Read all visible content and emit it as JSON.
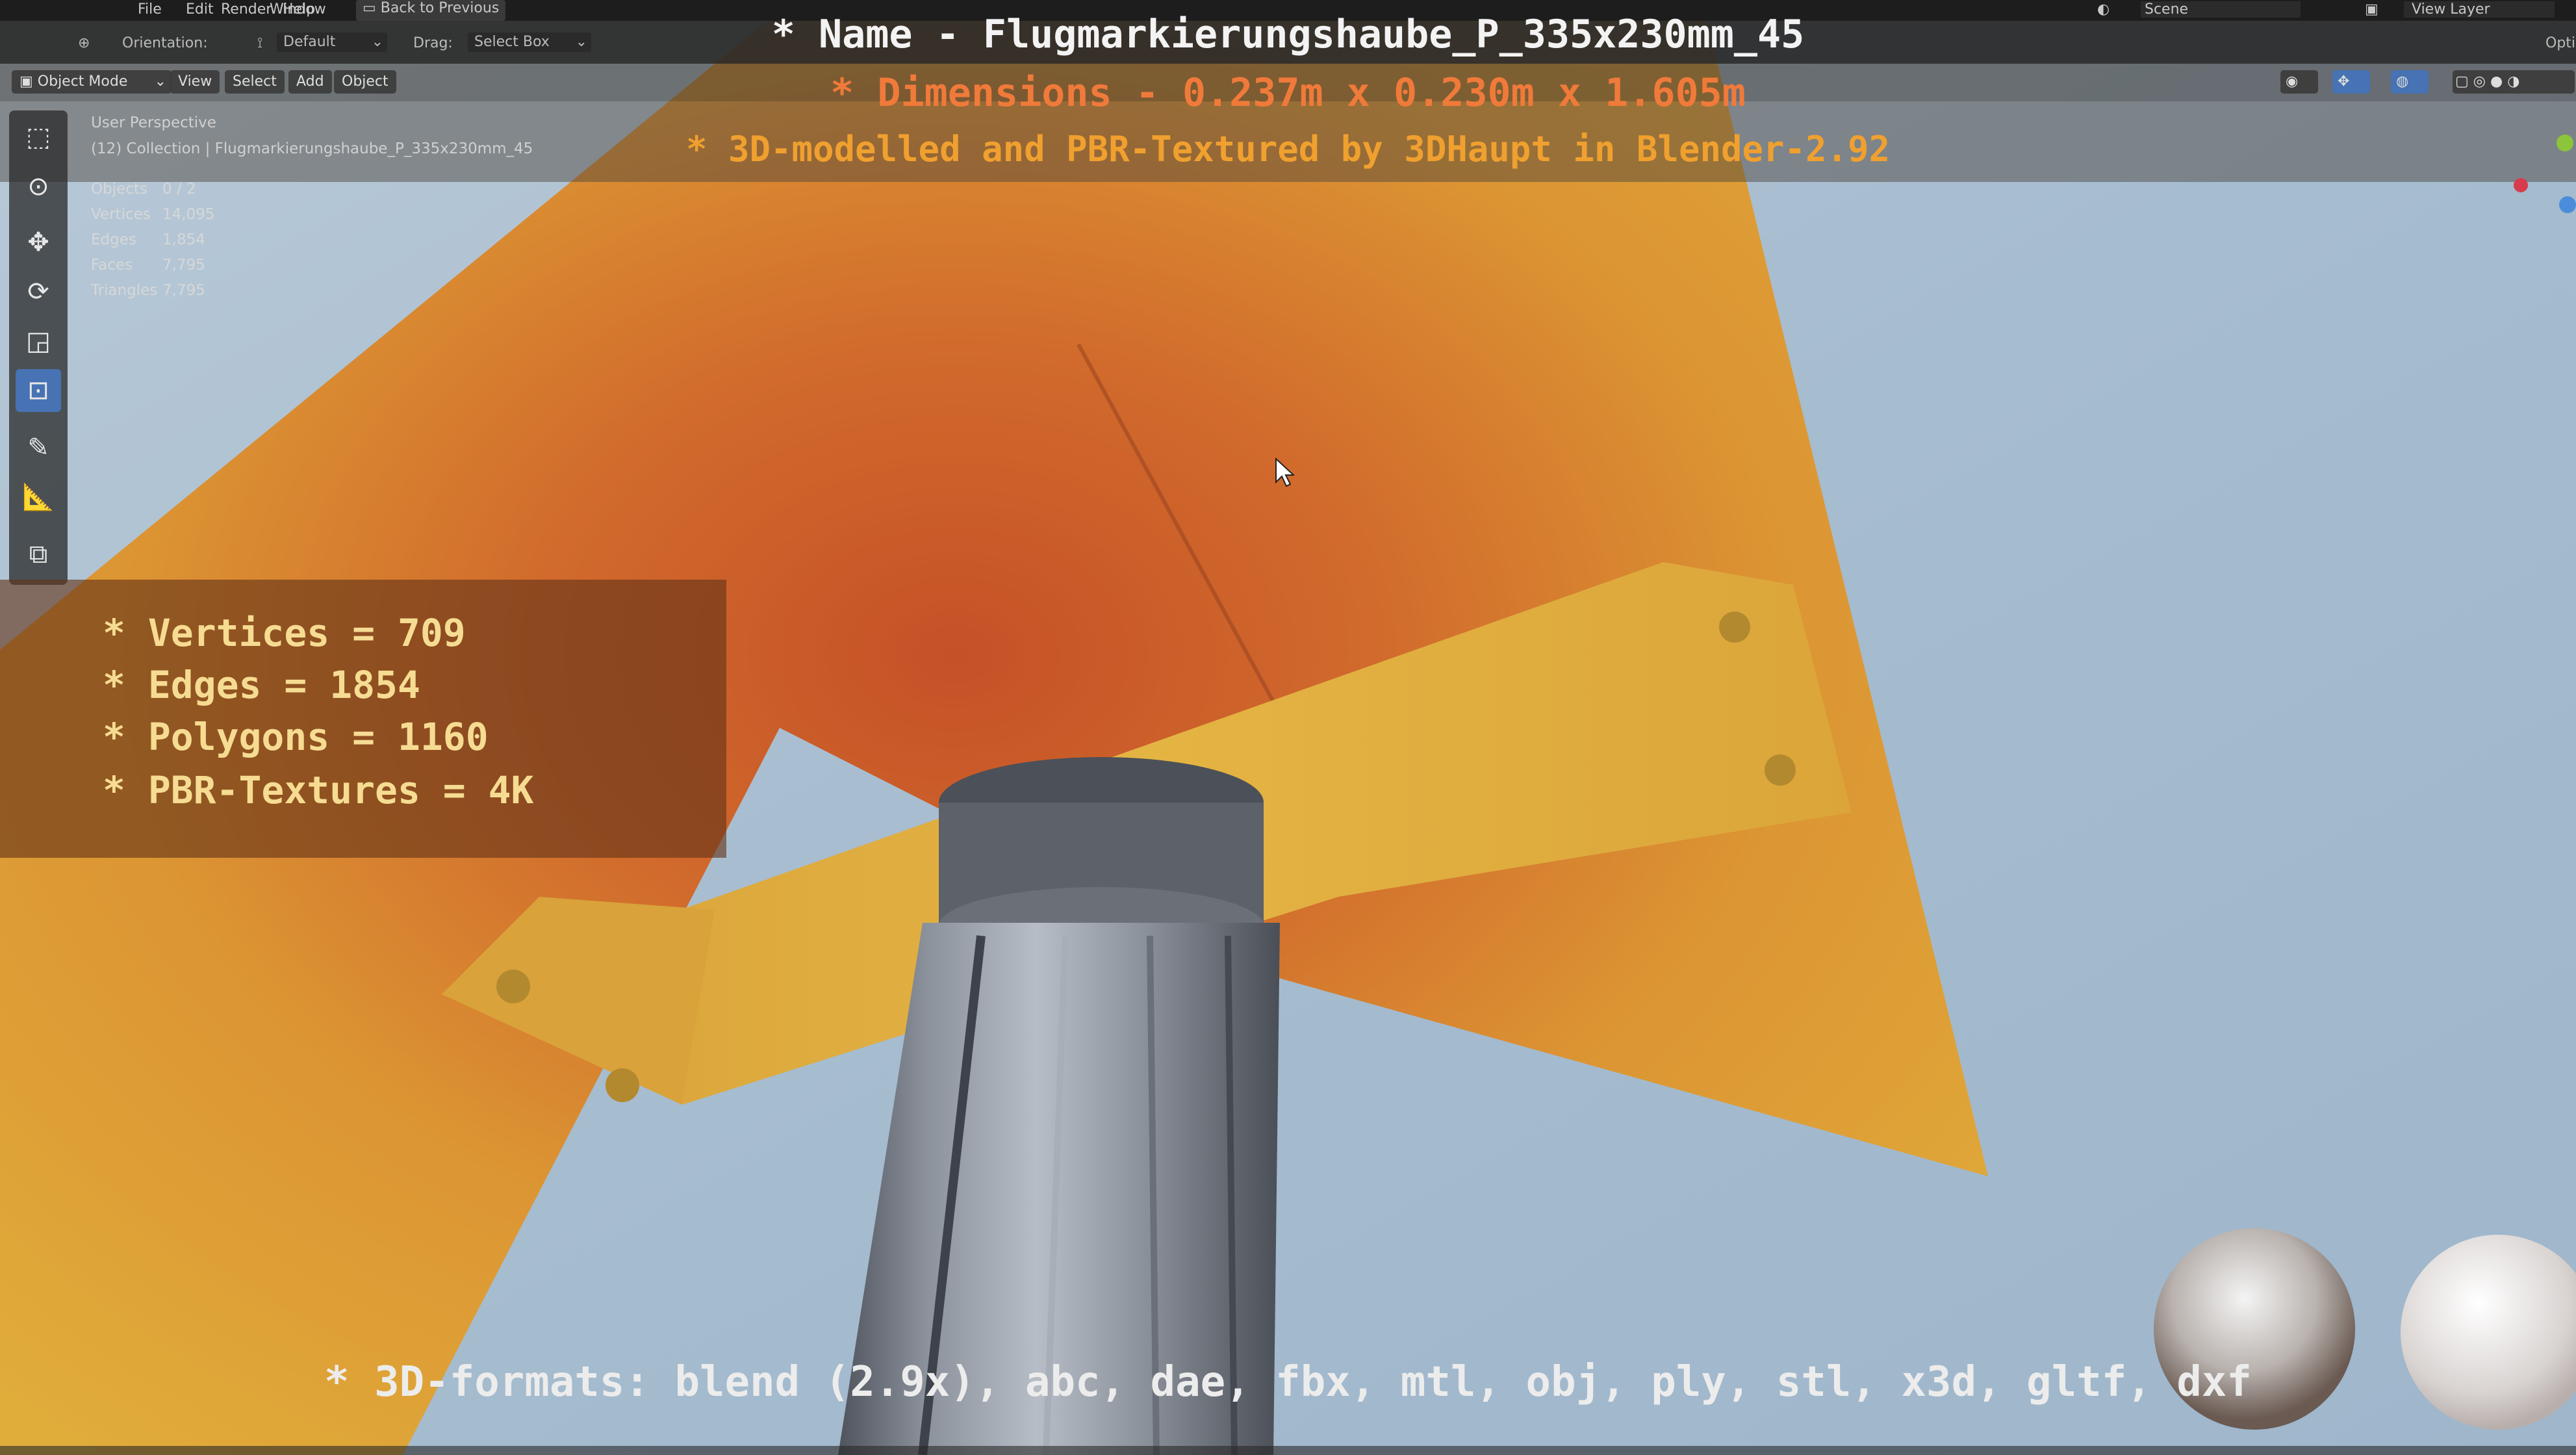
{
  "menubar": {
    "left_items": [
      "File",
      "Edit",
      "Render",
      "Window",
      "Help"
    ],
    "back_label": "Back to Previous",
    "scene_label": "Scene",
    "view_layer_label": "View Layer"
  },
  "header": {
    "orientation_label": "Orientation:",
    "orientation_value": "Default",
    "drag_label": "Drag:",
    "drag_value": "Select Box",
    "options_label": "Opti"
  },
  "modebar": {
    "mode": "Object Mode",
    "menus": [
      "View",
      "Select",
      "Add",
      "Object"
    ]
  },
  "viewport": {
    "perspective": "User Perspective",
    "collection": "(12) Collection | Flugmarkierungshaube_P_335x230mm_45",
    "stats": [
      {
        "label": "Objects",
        "value": "0 / 2"
      },
      {
        "label": "Vertices",
        "value": "14,095"
      },
      {
        "label": "Edges",
        "value": "1,854"
      },
      {
        "label": "Faces",
        "value": "7,795"
      },
      {
        "label": "Triangles",
        "value": "7,795"
      }
    ]
  },
  "overlay": {
    "name_line": "* Name - Flugmarkierungshaube_P_335x230mm_45",
    "dimensions_line": "* Dimensions -  0.237m x 0.230m x 1.605m",
    "credit_line": "* 3D-modelled and PBR-Textured by 3DHaupt in Blender-2.92",
    "stat_lines": [
      "* Vertices = 709",
      "* Edges = 1854",
      "* Polygons = 1160",
      "* PBR-Textures = 4K"
    ],
    "formats_line": "* 3D-formats: blend (2.9x), abc, dae, fbx, mtl, obj, ply, stl, x3d, gltf, dxf"
  },
  "tools": [
    "select-box",
    "cursor",
    "move",
    "rotate",
    "scale",
    "transform",
    "annotate",
    "measure",
    "add-cube"
  ],
  "colors": {
    "sky": "#a9bed0",
    "sign_yellow": "#e2ad2f",
    "sign_orange": "#d2692c",
    "accent_blue": "#4772b3",
    "title_orange": "#f07a3a"
  }
}
